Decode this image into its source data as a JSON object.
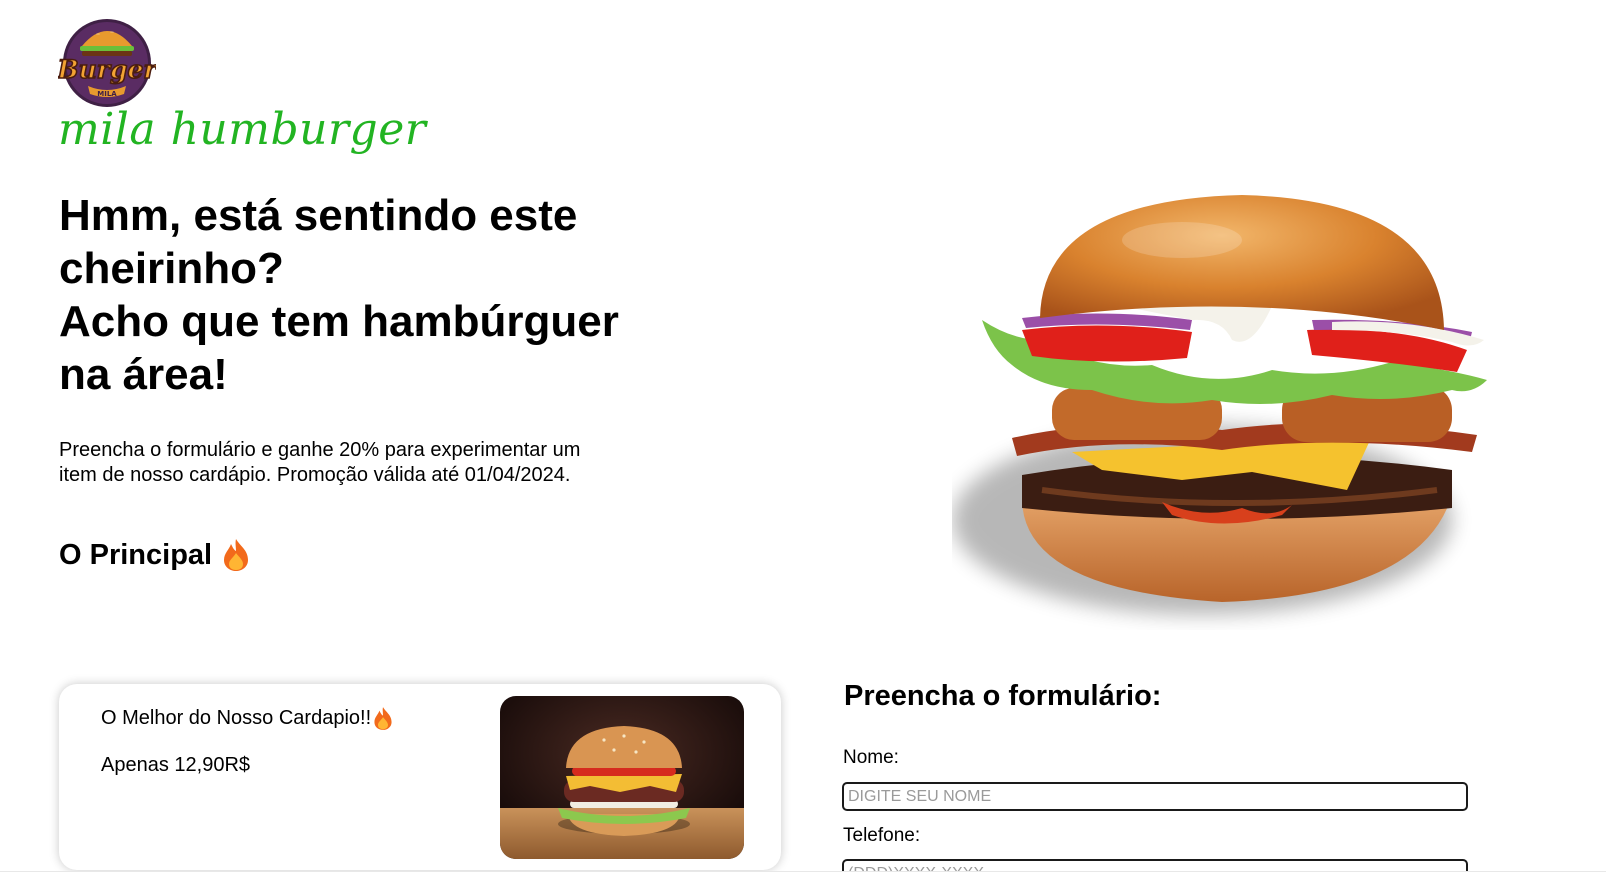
{
  "brand": {
    "logo_text_top": "Burger",
    "logo_text_bottom": "MILA",
    "name": "mila humburger",
    "accent_color": "#22b422"
  },
  "hero": {
    "headline_lines": [
      "Hmm, está sentindo este cheirinho?",
      "Acho que tem hambúrguer na área!"
    ],
    "intro": "Preencha o formulário e ganhe 20% para experimentar um item de nosso cardápio. Promoção válida até 01/04/2024.",
    "section_title": "O Principal",
    "section_icon": "fire-icon"
  },
  "product_card": {
    "title": "O Melhor do Nosso Cardapio!!",
    "title_icon": "fire-icon",
    "price": "Apenas 12,90R$"
  },
  "form": {
    "title": "Preencha o formulário:",
    "fields": [
      {
        "label": "Nome:",
        "placeholder": "DIGITE SEU NOME",
        "value": ""
      },
      {
        "label": "Telefone:",
        "placeholder": "(DDD)XXXX-XXXX",
        "value": ""
      }
    ]
  }
}
